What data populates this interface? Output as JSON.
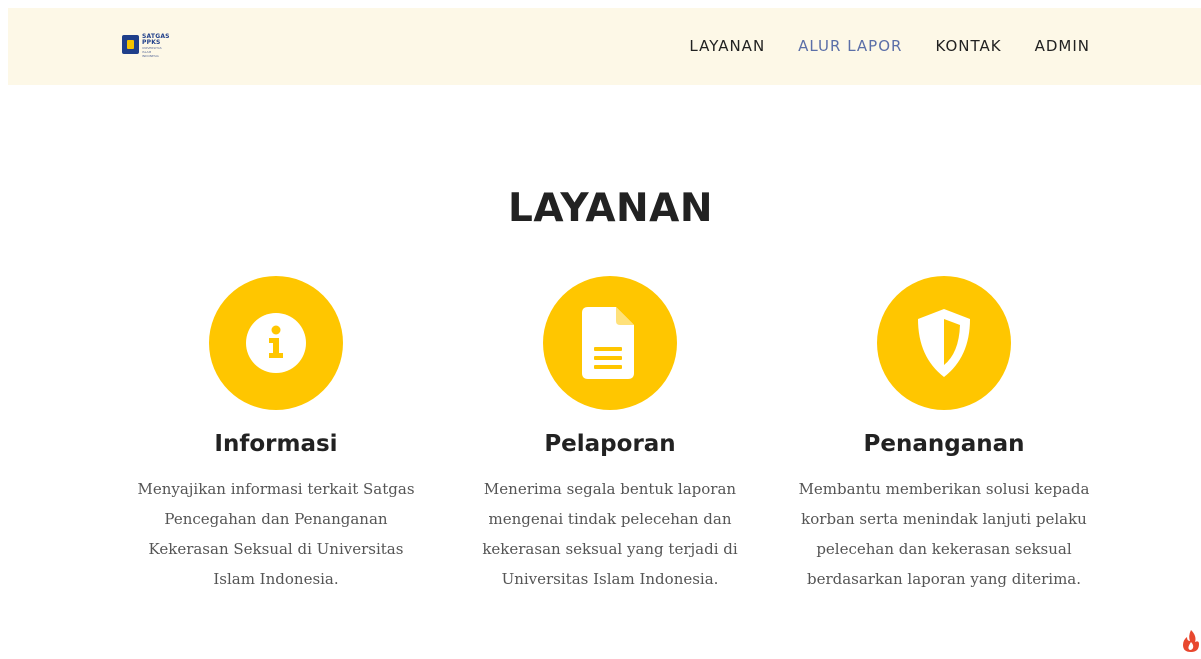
{
  "header": {
    "logo": {
      "line1": "SATGAS",
      "line2": "PPKS",
      "line3": "UNIVERSITAS",
      "line4": "ISLAM",
      "line5": "INDONESIA"
    },
    "nav": [
      {
        "label": "LAYANAN",
        "active": false
      },
      {
        "label": "ALUR LAPOR",
        "active": true
      },
      {
        "label": "KONTAK",
        "active": false
      },
      {
        "label": "ADMIN",
        "active": false
      }
    ]
  },
  "section": {
    "title": "LAYANAN"
  },
  "cards": [
    {
      "icon": "info-icon",
      "title": "Informasi",
      "description": "Menyajikan informasi terkait Satgas Pencegahan dan Penanganan Kekerasan Seksual di Universitas Islam Indonesia."
    },
    {
      "icon": "document-icon",
      "title": "Pelaporan",
      "description": "Menerima segala bentuk laporan mengenai tindak pelecehan dan kekerasan seksual yang terjadi di Universitas Islam Indonesia."
    },
    {
      "icon": "shield-icon",
      "title": "Penanganan",
      "description": "Membantu memberikan solusi kepada korban serta menindak lanjuti pelaku pelecehan dan kekerasan seksual berdasarkan laporan yang diterima."
    }
  ],
  "colors": {
    "accent": "#ffc600",
    "header_bg": "#fdf8e7",
    "nav_active": "#5b6fa8",
    "text": "#222222",
    "muted": "#555555"
  },
  "corner": {
    "icon": "flame-icon"
  }
}
